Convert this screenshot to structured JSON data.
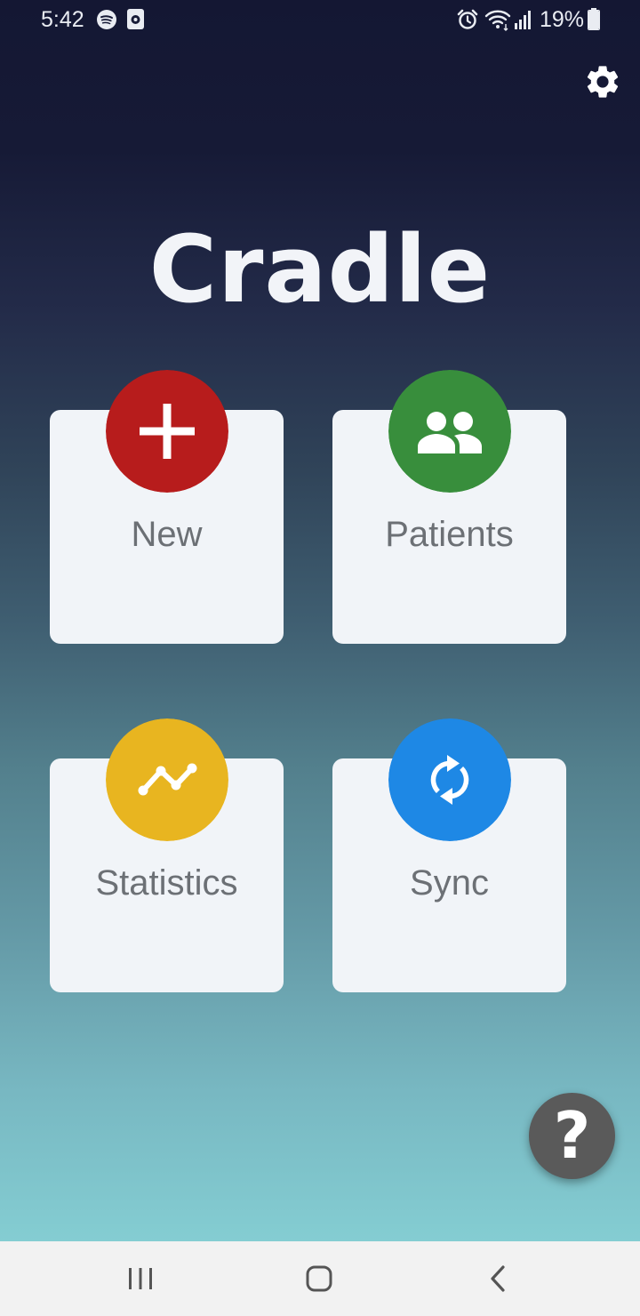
{
  "status_bar": {
    "time": "5:42",
    "battery_text": "19%",
    "icons": [
      "spotify-icon",
      "screen-record-icon",
      "alarm-icon",
      "wifi-icon",
      "signal-icon",
      "battery-icon"
    ]
  },
  "header": {
    "settings_icon": "gear-icon"
  },
  "app": {
    "title": "Cradle"
  },
  "tiles": [
    {
      "label": "New",
      "icon": "plus-icon",
      "color": "#b71c1c"
    },
    {
      "label": "Patients",
      "icon": "people-icon",
      "color": "#388e3c"
    },
    {
      "label": "Statistics",
      "icon": "trend-line-icon",
      "color": "#e8b520"
    },
    {
      "label": "Sync",
      "icon": "sync-icon",
      "color": "#1e88e5"
    }
  ],
  "help": {
    "glyph": "?",
    "color": "#5a5a5a"
  },
  "nav": {
    "items": [
      "recent-apps-icon",
      "home-icon",
      "back-icon"
    ]
  }
}
